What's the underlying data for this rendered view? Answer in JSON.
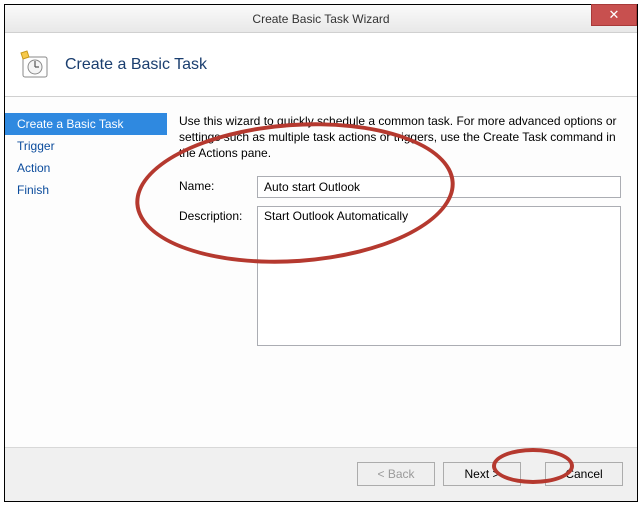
{
  "window": {
    "title": "Create Basic Task Wizard",
    "close_glyph": "✕"
  },
  "header": {
    "title": "Create a Basic Task"
  },
  "sidebar": {
    "items": [
      {
        "label": "Create a Basic Task",
        "active": true
      },
      {
        "label": "Trigger",
        "active": false
      },
      {
        "label": "Action",
        "active": false
      },
      {
        "label": "Finish",
        "active": false
      }
    ]
  },
  "main": {
    "intro": "Use this wizard to quickly schedule a common task.  For more advanced options or settings such as multiple task actions or triggers, use the Create Task command in the Actions pane.",
    "name_label": "Name:",
    "name_value": "Auto start Outlook",
    "desc_label": "Description:",
    "desc_value": "Start Outlook Automatically "
  },
  "footer": {
    "back": "< Back",
    "next": "Next >",
    "cancel": "Cancel"
  }
}
